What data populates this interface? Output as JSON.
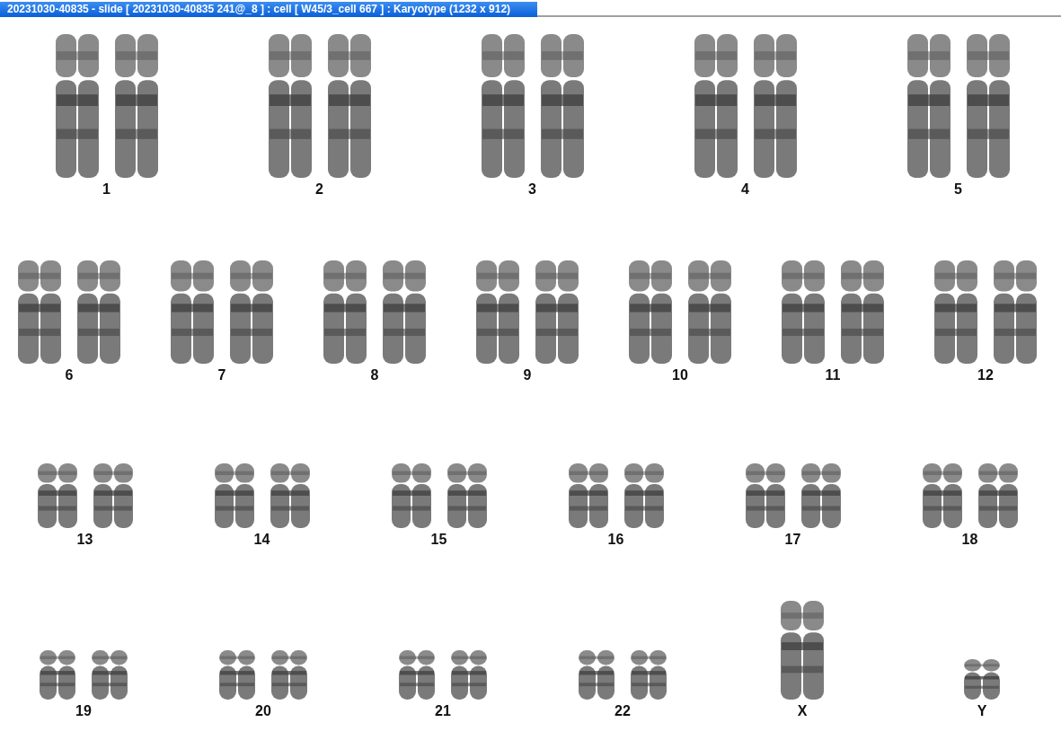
{
  "window": {
    "title": "20231030-40835 - slide [ 20231030-40835 241@_8 ] : cell [ W45/3_cell 667 ] : Karyotype  (1232 x 912)"
  },
  "karyotype": {
    "rows": [
      {
        "groups": [
          {
            "label": "1",
            "kind": "pair"
          },
          {
            "label": "2",
            "kind": "pair"
          },
          {
            "label": "3",
            "kind": "pair"
          },
          {
            "label": "4",
            "kind": "pair"
          },
          {
            "label": "5",
            "kind": "pair"
          }
        ]
      },
      {
        "groups": [
          {
            "label": "6",
            "kind": "pair"
          },
          {
            "label": "7",
            "kind": "pair"
          },
          {
            "label": "8",
            "kind": "pair"
          },
          {
            "label": "9",
            "kind": "pair"
          },
          {
            "label": "10",
            "kind": "pair"
          },
          {
            "label": "11",
            "kind": "pair"
          },
          {
            "label": "12",
            "kind": "pair"
          }
        ]
      },
      {
        "groups": [
          {
            "label": "13",
            "kind": "pair"
          },
          {
            "label": "14",
            "kind": "pair"
          },
          {
            "label": "15",
            "kind": "pair"
          },
          {
            "label": "16",
            "kind": "pair"
          },
          {
            "label": "17",
            "kind": "pair"
          },
          {
            "label": "18",
            "kind": "pair"
          }
        ]
      },
      {
        "groups": [
          {
            "label": "19",
            "kind": "pair"
          },
          {
            "label": "20",
            "kind": "pair"
          },
          {
            "label": "21",
            "kind": "pair"
          },
          {
            "label": "22",
            "kind": "pair"
          },
          {
            "label": "X",
            "kind": "single"
          },
          {
            "label": "Y",
            "kind": "single"
          }
        ]
      }
    ]
  }
}
